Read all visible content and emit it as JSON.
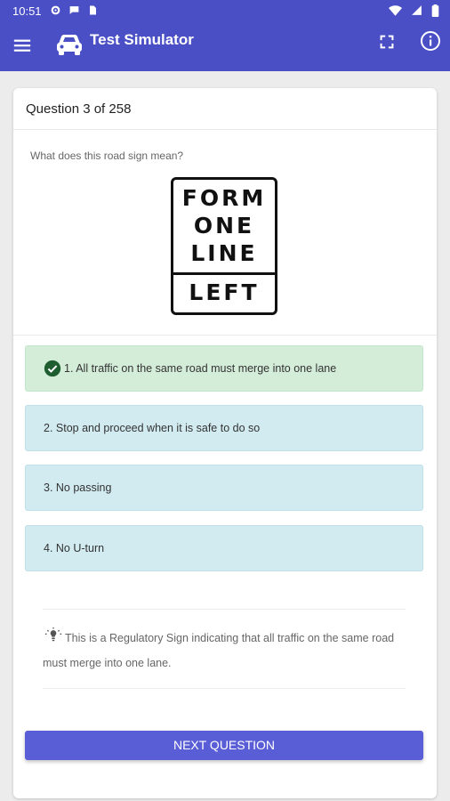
{
  "status": {
    "time": "10:51"
  },
  "appbar": {
    "title": "Test Simulator"
  },
  "question": {
    "counter": "Question 3 of 258",
    "prompt": "What does this road sign mean?",
    "sign_lines": [
      "FORM",
      "ONE",
      "LINE",
      "LEFT"
    ]
  },
  "answers": [
    {
      "label": "1. All traffic on the same road must merge into one lane",
      "state": "correct"
    },
    {
      "label": "2. Stop and proceed when it is safe to do so",
      "state": "option"
    },
    {
      "label": "3. No passing",
      "state": "option"
    },
    {
      "label": "4. No U-turn",
      "state": "option"
    }
  ],
  "explanation": "This is a Regulatory Sign indicating that all traffic on the same road must merge into one lane.",
  "next_button": "NEXT QUESTION",
  "colors": {
    "primary": "#4a4fc6",
    "correct_bg": "#d4edd9",
    "option_bg": "#d2ebf1",
    "button": "#5a5ed6"
  },
  "icons": [
    "menu-icon",
    "car-icon",
    "fullscreen-icon",
    "info-icon",
    "check-circle-icon",
    "lightbulb-icon",
    "settings-icon",
    "chat-icon",
    "sim-card-icon",
    "wifi-icon",
    "battery-icon"
  ]
}
